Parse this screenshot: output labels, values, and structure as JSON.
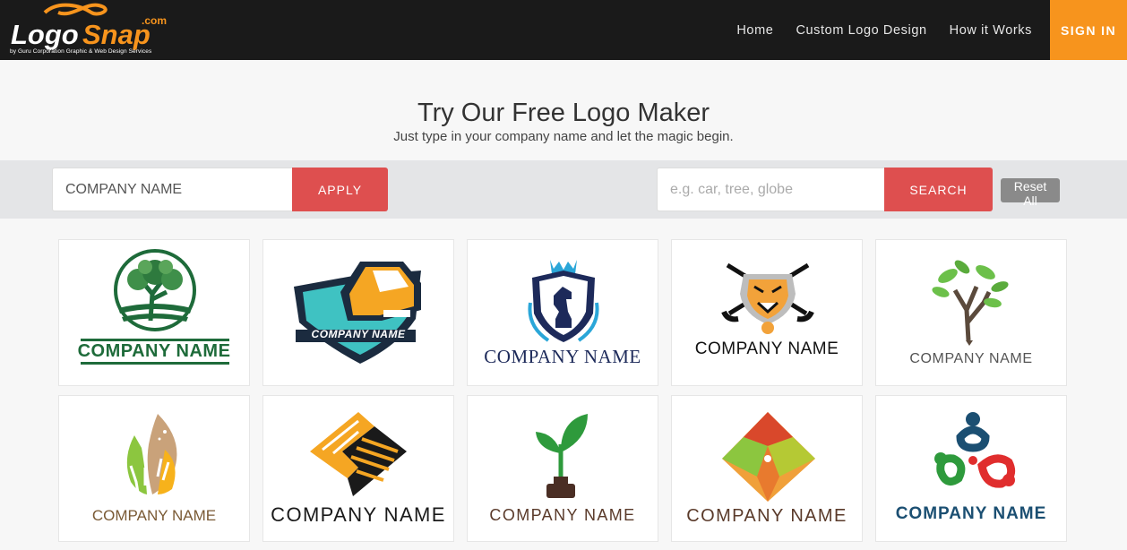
{
  "brand": {
    "logo_text_1": "Logo",
    "logo_text_2": "Snap",
    "logo_domain": ".com",
    "tagline": "by Guru Corporation Graphic & Web Design Services"
  },
  "nav": {
    "items": [
      {
        "label": "Home"
      },
      {
        "label": "Custom Logo Design"
      },
      {
        "label": "How it Works"
      }
    ],
    "signin_label": "SIGN IN"
  },
  "hero": {
    "title": "Try Our Free Logo Maker",
    "subtitle": "Just type in your company name and let the magic begin."
  },
  "toolbar": {
    "company_value": "COMPANY NAME",
    "apply_label": "APPLY",
    "search_placeholder": "e.g. car, tree, globe",
    "search_label": "SEARCH",
    "reset_label": "Reset All"
  },
  "colors": {
    "nav_bg": "#1a1a1a",
    "accent_orange": "#f7941d",
    "button_red": "#de4f4f",
    "reset_gray": "#8a8a8a"
  },
  "logos": [
    {
      "icon": "tree-circle-icon",
      "company": "COMPANY NAME"
    },
    {
      "icon": "truck-shield-icon",
      "company": "COMPANY NAME"
    },
    {
      "icon": "chess-knight-crest-icon",
      "company": "COMPANY NAME"
    },
    {
      "icon": "tiger-hockey-icon",
      "company": "COMPANY NAME"
    },
    {
      "icon": "pen-tree-icon",
      "company": "COMPANY NAME"
    },
    {
      "icon": "hands-leaf-icon",
      "company": "COMPANY NAME"
    },
    {
      "icon": "pyramid-stairs-icon",
      "company": "COMPANY NAME"
    },
    {
      "icon": "sprout-inkwell-icon",
      "company": "COMPANY NAME"
    },
    {
      "icon": "diamond-landscape-icon",
      "company": "COMPANY NAME"
    },
    {
      "icon": "people-cluster-icon",
      "company": "COMPANY NAME"
    }
  ]
}
